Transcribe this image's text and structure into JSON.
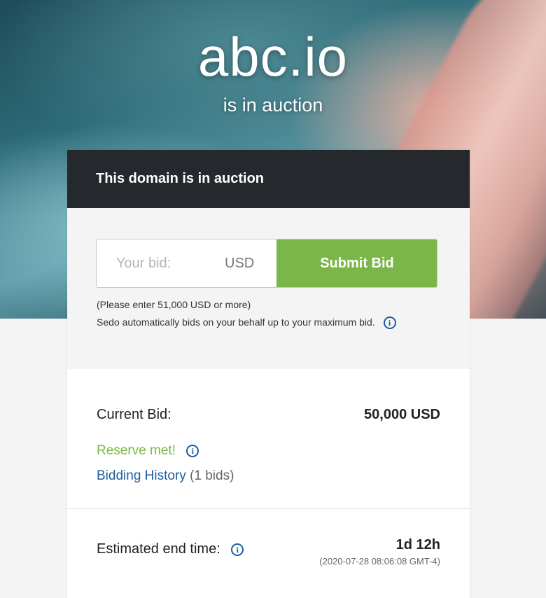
{
  "hero": {
    "domain": "abc.io",
    "subtitle": "is in auction"
  },
  "card": {
    "header": "This domain is in auction",
    "bid_form": {
      "placeholder": "Your bid:",
      "currency": "USD",
      "submit_label": "Submit Bid"
    },
    "notes": {
      "minimum": "(Please enter 51,000 USD or more)",
      "auto_bid": "Sedo automatically bids on your behalf up to your maximum bid."
    },
    "current_bid": {
      "label": "Current Bid:",
      "value": "50,000 USD",
      "reserve": "Reserve met!",
      "history_link": "Bidding History",
      "history_count": "(1 bids)"
    },
    "end_time": {
      "label": "Estimated end time:",
      "remaining": "1d 12h",
      "date": "(2020-07-28 08:06:08 GMT-4)"
    }
  },
  "icons": {
    "info": "info-icon"
  },
  "colors": {
    "accent_green": "#7ab648",
    "link_blue": "#1b5e9f",
    "header_dark": "#25282d"
  }
}
